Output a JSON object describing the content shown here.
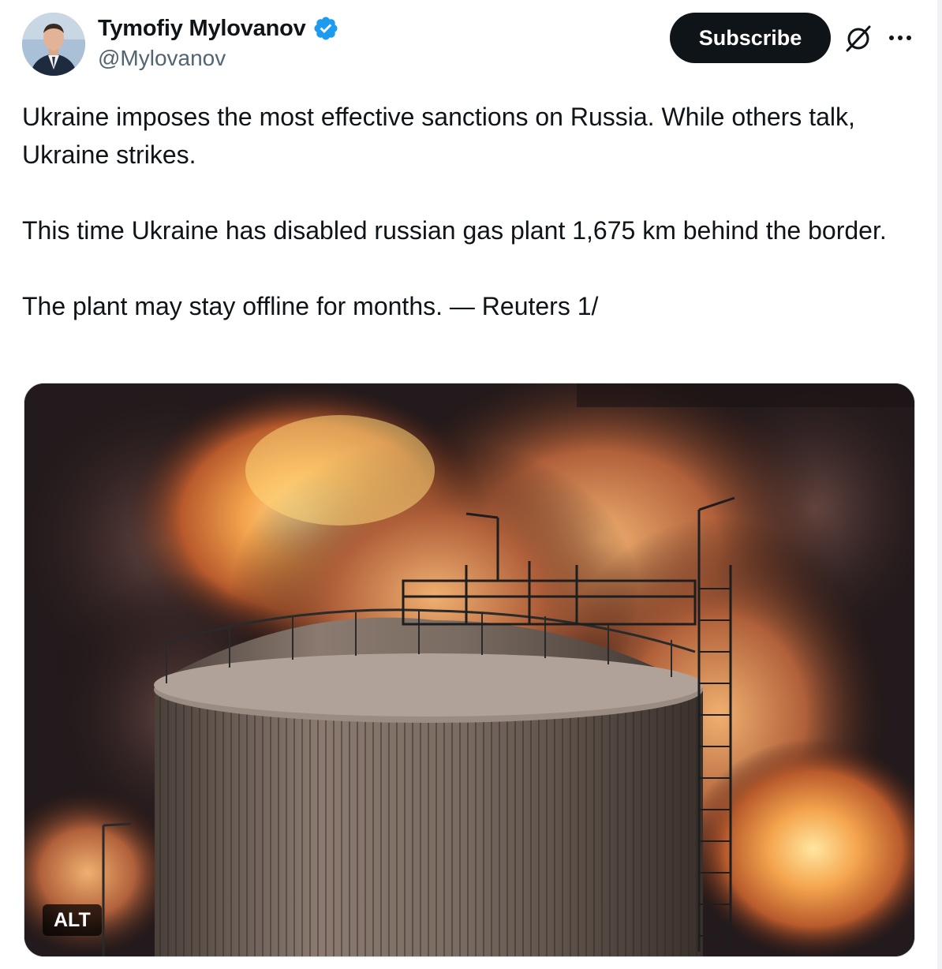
{
  "author": {
    "display_name": "Tymofiy Mylovanov",
    "handle": "@Mylovanov",
    "avatar_icon": "profile-photo",
    "verified_icon": "verified-badge-icon",
    "verified_color": "#1d9bf0"
  },
  "actions": {
    "subscribe_label": "Subscribe",
    "grok_icon": "grok-icon",
    "more_icon": "more-horizontal-icon"
  },
  "tweet": {
    "paragraphs": [
      "Ukraine imposes the most effective sanctions on Russia. While others talk, Ukraine strikes.",
      "This time Ukraine has disabled russian gas plant 1,675 km behind the border.",
      "The plant may stay offline for months. — Reuters 1/"
    ]
  },
  "media": {
    "description_icon": "photo-storage-tank-fire",
    "alt_label": "ALT"
  },
  "colors": {
    "text_primary": "#0f1419",
    "text_secondary": "#536471",
    "button_bg": "#0f1419"
  }
}
